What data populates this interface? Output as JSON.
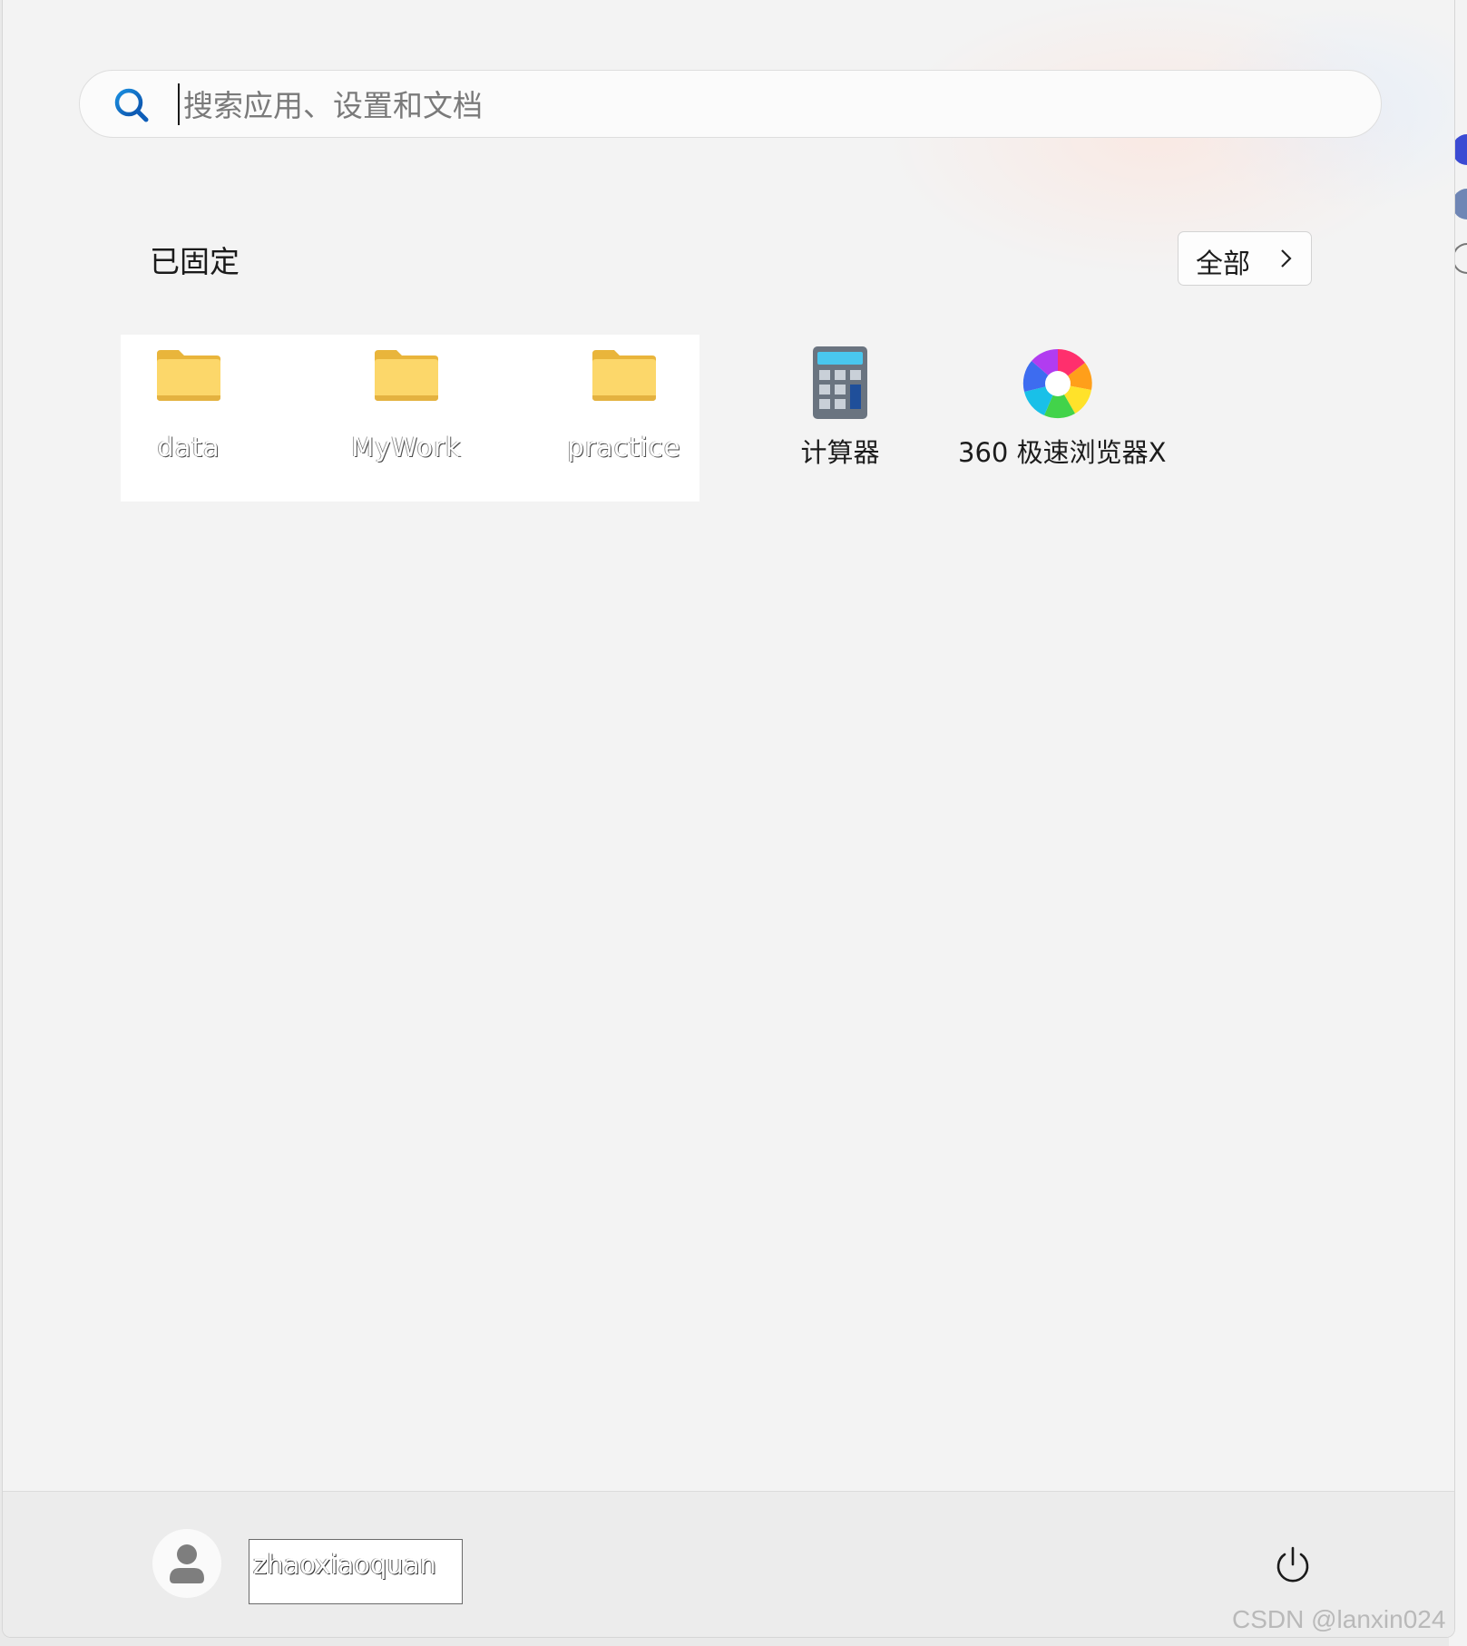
{
  "search": {
    "placeholder": "搜索应用、设置和文档"
  },
  "pinned": {
    "title": "已固定",
    "all_button": "全部",
    "items": [
      {
        "label": "data",
        "icon": "folder-icon"
      },
      {
        "label": "MyWork",
        "icon": "folder-icon"
      },
      {
        "label": "practice",
        "icon": "folder-icon"
      },
      {
        "label": "计算器",
        "icon": "calculator-icon"
      },
      {
        "label": "360 极速浏览器X",
        "icon": "browser-icon"
      }
    ]
  },
  "footer": {
    "user_name": "zhaoxiaoquan"
  },
  "watermark": "CSDN @lanxin024"
}
